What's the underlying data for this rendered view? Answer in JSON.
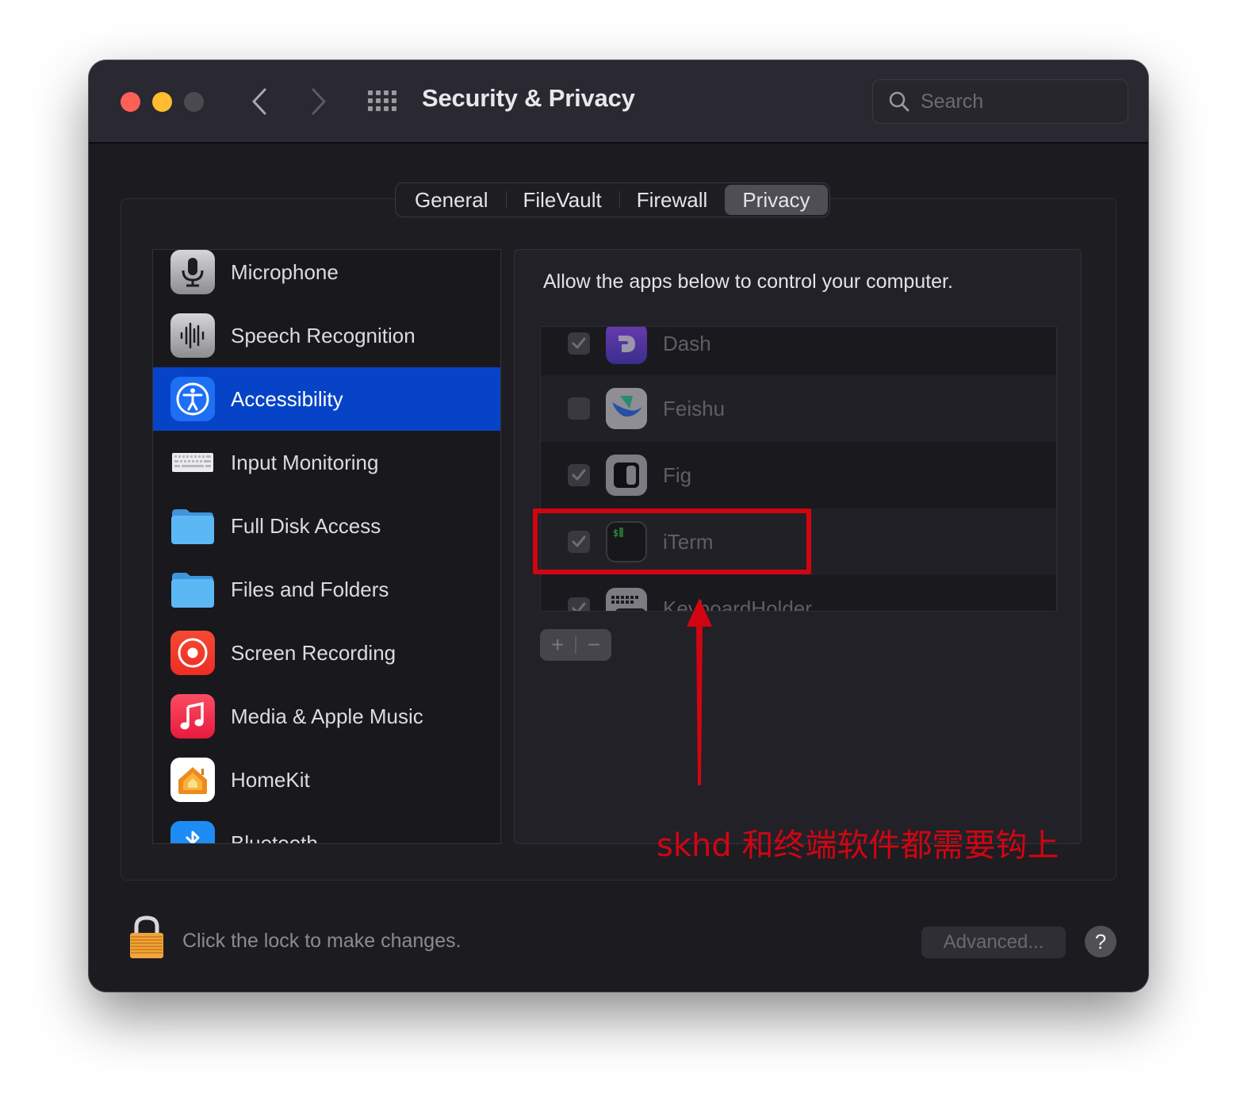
{
  "window": {
    "title": "Security & Privacy",
    "traffic_lights": [
      "close",
      "minimize",
      "zoom"
    ],
    "nav": {
      "back_icon": "chevron-left-icon",
      "forward_icon": "chevron-right-icon",
      "grid_icon": "grid-icon"
    },
    "search": {
      "placeholder": "Search",
      "value": ""
    }
  },
  "tabs": [
    {
      "label": "General",
      "active": false
    },
    {
      "label": "FileVault",
      "active": false
    },
    {
      "label": "Firewall",
      "active": false
    },
    {
      "label": "Privacy",
      "active": true
    }
  ],
  "sidebar": {
    "selected": "Accessibility",
    "items": [
      {
        "label": "Microphone",
        "icon": "microphone-icon"
      },
      {
        "label": "Speech Recognition",
        "icon": "waveform-icon"
      },
      {
        "label": "Accessibility",
        "icon": "accessibility-icon"
      },
      {
        "label": "Input Monitoring",
        "icon": "keyboard-icon"
      },
      {
        "label": "Full Disk Access",
        "icon": "folder-icon"
      },
      {
        "label": "Files and Folders",
        "icon": "folder-icon"
      },
      {
        "label": "Screen Recording",
        "icon": "screen-recording-icon"
      },
      {
        "label": "Media & Apple Music",
        "icon": "music-note-icon"
      },
      {
        "label": "HomeKit",
        "icon": "home-icon"
      },
      {
        "label": "Bluetooth",
        "icon": "bluetooth-icon"
      }
    ]
  },
  "content": {
    "description": "Allow the apps below to control your computer.",
    "apps": [
      {
        "name": "Dash",
        "checked": true,
        "icon": "dash-app-icon"
      },
      {
        "name": "Feishu",
        "checked": false,
        "icon": "feishu-app-icon"
      },
      {
        "name": "Fig",
        "checked": true,
        "icon": "fig-app-icon"
      },
      {
        "name": "iTerm",
        "checked": true,
        "icon": "iterm-app-icon",
        "iterm_prompt": "$"
      },
      {
        "name": "KeyboardHolder",
        "checked": true,
        "icon": "keyboard-holder-app-icon"
      }
    ],
    "add_label": "+",
    "remove_label": "−"
  },
  "footer": {
    "lock_text": "Click the lock to make changes.",
    "advanced_label": "Advanced...",
    "help_label": "?"
  },
  "annotation": {
    "text": "skhd 和终端软件都需要钩上",
    "color": "#d10512",
    "highlighted_app": "iTerm"
  },
  "colors": {
    "selection": "#0643c7",
    "close": "#fe5f57",
    "minimize": "#febc2e",
    "zoom_disabled": "#4b4a50"
  }
}
